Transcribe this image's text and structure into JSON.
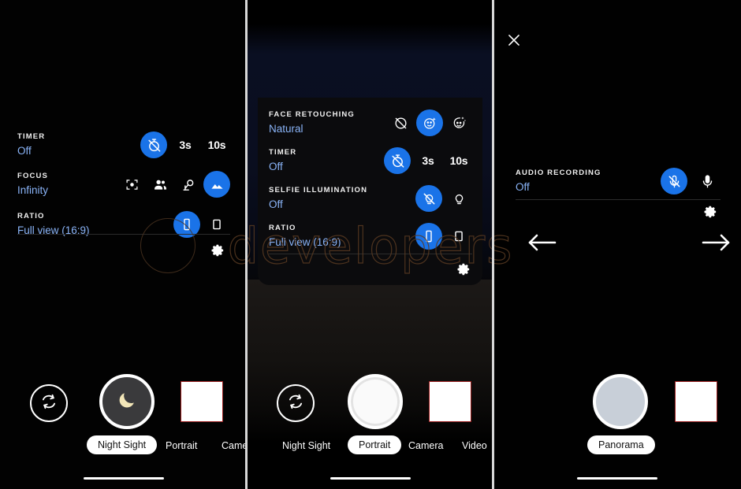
{
  "watermark": {
    "text": "developers"
  },
  "panels": [
    {
      "id": "night-sight",
      "settings": [
        {
          "label": "TIMER",
          "value": "Off",
          "options": [
            {
              "icon": "timer-off-icon",
              "label": "",
              "selected": true
            },
            {
              "icon": "text-icon",
              "label": "3s",
              "selected": false
            },
            {
              "icon": "text-icon",
              "label": "10s",
              "selected": false
            }
          ]
        },
        {
          "label": "FOCUS",
          "value": "Infinity",
          "options": [
            {
              "icon": "focus-auto-icon",
              "label": "",
              "selected": false
            },
            {
              "icon": "focus-faces-icon",
              "label": "",
              "selected": false
            },
            {
              "icon": "focus-macro-icon",
              "label": "",
              "selected": false
            },
            {
              "icon": "focus-infinity-icon",
              "label": "",
              "selected": true
            }
          ]
        },
        {
          "label": "RATIO",
          "value": "Full view (16:9)",
          "options": [
            {
              "icon": "ratio-full-icon",
              "label": "",
              "selected": true
            },
            {
              "icon": "ratio-43-icon",
              "label": "",
              "selected": false
            }
          ]
        }
      ],
      "gear": "settings-gear-icon",
      "shutter": {
        "icon": "moon-icon"
      },
      "flip": {
        "icon": "camera-flip-icon"
      },
      "thumbnail": {
        "name": "gallery-thumbnail"
      },
      "modes": [
        {
          "label": "Night Sight",
          "active": true
        },
        {
          "label": "Portrait",
          "active": false
        },
        {
          "label": "Camera",
          "active": false
        }
      ]
    },
    {
      "id": "portrait",
      "settings": [
        {
          "label": "FACE RETOUCHING",
          "value": "Natural",
          "options": [
            {
              "icon": "face-off-icon",
              "label": "",
              "selected": false
            },
            {
              "icon": "face-natural-icon",
              "label": "",
              "selected": true
            },
            {
              "icon": "face-soft-icon",
              "label": "",
              "selected": false
            }
          ]
        },
        {
          "label": "TIMER",
          "value": "Off",
          "options": [
            {
              "icon": "timer-off-icon",
              "label": "",
              "selected": true
            },
            {
              "icon": "text-icon",
              "label": "3s",
              "selected": false
            },
            {
              "icon": "text-icon",
              "label": "10s",
              "selected": false
            }
          ]
        },
        {
          "label": "SELFIE ILLUMINATION",
          "value": "Off",
          "options": [
            {
              "icon": "bulb-off-icon",
              "label": "",
              "selected": true
            },
            {
              "icon": "bulb-on-icon",
              "label": "",
              "selected": false
            }
          ]
        },
        {
          "label": "RATIO",
          "value": "Full view (16:9)",
          "options": [
            {
              "icon": "ratio-full-icon",
              "label": "",
              "selected": true
            },
            {
              "icon": "ratio-43-icon",
              "label": "",
              "selected": false
            }
          ]
        }
      ],
      "gear": "settings-gear-icon",
      "shutter": {
        "icon": "shutter-circle-icon"
      },
      "flip": {
        "icon": "camera-flip-icon"
      },
      "thumbnail": {
        "name": "gallery-thumbnail"
      },
      "modes": [
        {
          "label": "Night Sight",
          "active": false
        },
        {
          "label": "Portrait",
          "active": true
        },
        {
          "label": "Camera",
          "active": false
        },
        {
          "label": "Video",
          "active": false
        }
      ]
    },
    {
      "id": "panorama",
      "close": "close-icon",
      "settings": [
        {
          "label": "AUDIO RECORDING",
          "value": "Off",
          "options": [
            {
              "icon": "mic-off-icon",
              "label": "",
              "selected": true
            },
            {
              "icon": "mic-on-icon",
              "label": "",
              "selected": false
            }
          ]
        }
      ],
      "gear": "settings-gear-icon",
      "arrows": [
        {
          "icon": "arrow-left-icon"
        },
        {
          "icon": "arrow-right-icon"
        }
      ],
      "shutter": {
        "icon": "shutter-grey-icon"
      },
      "thumbnail": {
        "name": "gallery-thumbnail"
      },
      "modes": [
        {
          "label": "Panorama",
          "active": true
        }
      ]
    }
  ],
  "colors": {
    "accent": "#1a73e8",
    "value_text": "#8ab4f8",
    "label_text": "#f1f1f1",
    "thumb_border": "#9b1f1f",
    "watermark": "#5a3b22"
  }
}
